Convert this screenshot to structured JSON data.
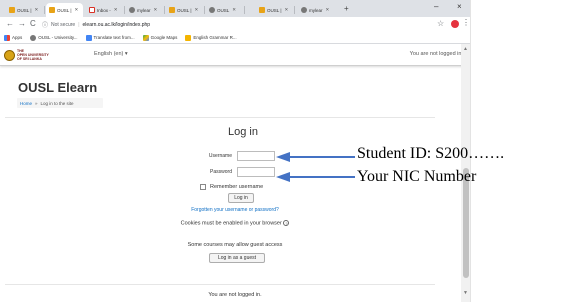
{
  "browser": {
    "tabs": [
      {
        "label": "OUSL |",
        "active": false,
        "icon": "ousl-favicon"
      },
      {
        "label": "OUSL |",
        "active": true,
        "icon": "ousl-favicon"
      },
      {
        "label": "Inbox -",
        "active": false,
        "icon": "gmail-favicon"
      },
      {
        "label": "mylear",
        "active": false,
        "icon": "moodle-favicon"
      },
      {
        "label": "OUSL |",
        "active": false,
        "icon": "ousl-favicon"
      },
      {
        "label": "OUSL",
        "active": false,
        "icon": "globe-favicon"
      },
      {
        "label": "OUSL |",
        "active": false,
        "icon": "ousl-favicon"
      },
      {
        "label": "mylear",
        "active": false,
        "icon": "moodle-favicon"
      }
    ],
    "new_tab": "+",
    "window": {
      "minimize": "–",
      "close": "×"
    },
    "nav": {
      "back": "←",
      "forward": "→",
      "reload": "C"
    },
    "omnibox": {
      "security": "Not secure",
      "url": "elearn.ou.ac.lk/login/index.php"
    },
    "bookmarks": [
      {
        "label": "Apps",
        "icon": "apps-icon"
      },
      {
        "label": "OUSL - University...",
        "icon": "globe-icon"
      },
      {
        "label": "Translate text from...",
        "icon": "translate-icon"
      },
      {
        "label": "Google Maps",
        "icon": "maps-icon"
      },
      {
        "label": "English Grammar R...",
        "icon": "grammar-icon"
      }
    ]
  },
  "header": {
    "logo_line1": "THE",
    "logo_line2": "OPEN UNIVERSITY",
    "logo_line3": "OF SRI LANKA",
    "language": "English (en) ▾",
    "not_logged_in": "You are not logged in."
  },
  "page": {
    "site_title": "OUSL Elearn",
    "breadcrumb_home": "Home",
    "breadcrumb_sep": "»",
    "breadcrumb_current": "Log in to the site"
  },
  "login": {
    "heading": "Log in",
    "username_label": "Username",
    "password_label": "Password",
    "remember_label": "Remember username",
    "login_button": "Log in",
    "forgot_link": "Forgotten your username or password?",
    "cookies_text": "Cookies must be enabled in your browser",
    "cookies_help": "?",
    "guest_note": "Some courses may allow guest access",
    "guest_button": "Log in as a guest"
  },
  "footer": {
    "text": "You are not logged in."
  },
  "annotations": {
    "student_id": "Student ID: S200…….",
    "nic": "Your NIC Number",
    "arrow_color": "#4472c4"
  }
}
